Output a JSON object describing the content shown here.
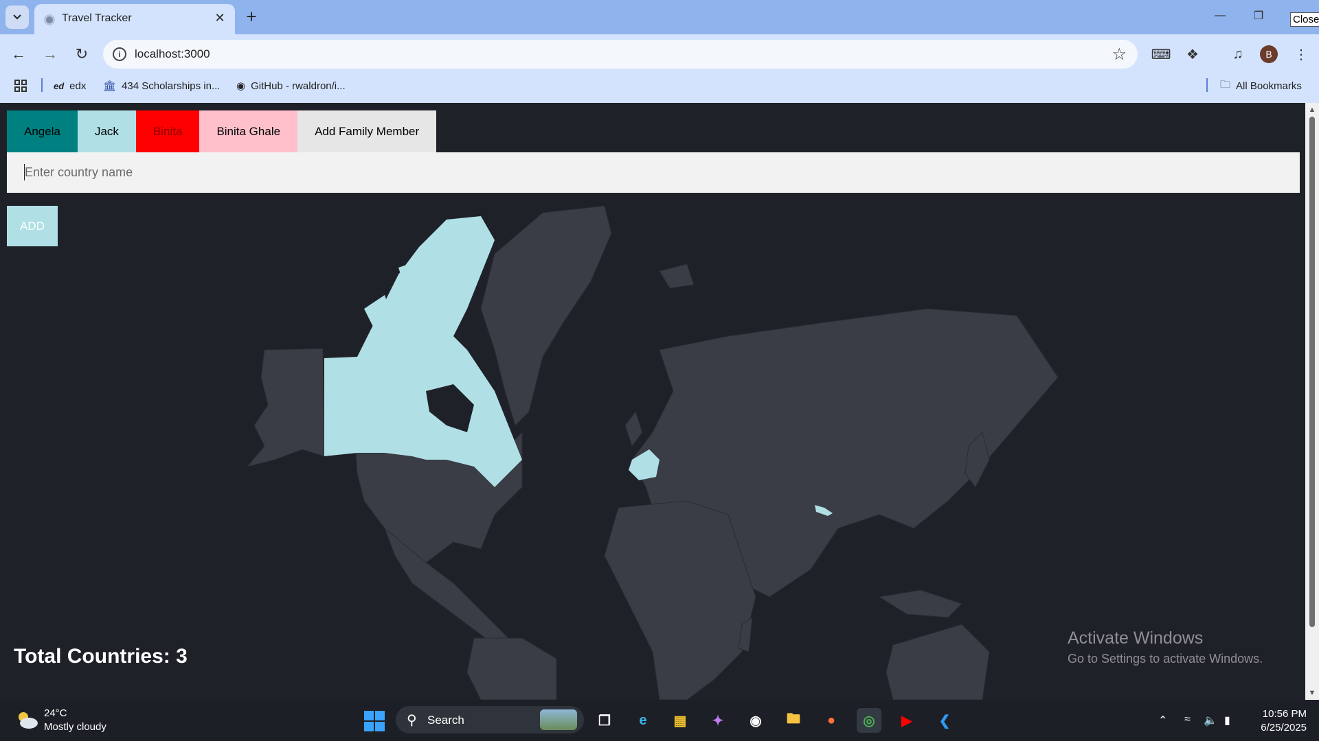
{
  "browser": {
    "tab_title": "Travel Tracker",
    "tab_close": "✕",
    "new_tab": "+",
    "url": "localhost:3000",
    "profile_initial": "B",
    "close_tooltip": "Close",
    "bookmarks": [
      {
        "label": "edx",
        "icon": "edx-icon"
      },
      {
        "label": "434 Scholarships in...",
        "icon": "institution-icon"
      },
      {
        "label": "GitHub - rwaldron/i...",
        "icon": "github-icon"
      }
    ],
    "all_bookmarks": "All Bookmarks"
  },
  "app": {
    "members": [
      {
        "label": "Angela",
        "color": "#008080",
        "text_color": "#000000"
      },
      {
        "label": "Jack",
        "color": "#b0e0e6",
        "text_color": "#000000"
      },
      {
        "label": "Binita",
        "color": "#ff0000",
        "text_color": "#8b0000"
      },
      {
        "label": "Binita Ghale",
        "color": "#ffc0cb",
        "text_color": "#000000"
      },
      {
        "label": "Add Family Member",
        "color": "#e6e6e6",
        "text_color": "#000000"
      }
    ],
    "country_placeholder": "Enter country name",
    "add_label": "ADD",
    "total_label": "Total Countries: 3",
    "visited_countries": [
      "Canada",
      "France",
      "Nepal"
    ],
    "visited_color": "#b0e0e6",
    "land_color": "#3a3d46",
    "background_color": "#1f2128"
  },
  "watermark": {
    "title": "Activate Windows",
    "subtitle": "Go to Settings to activate Windows."
  },
  "taskbar": {
    "temperature": "24°C",
    "weather": "Mostly cloudy",
    "search_label": "Search",
    "time": "10:56 PM",
    "date": "6/25/2025",
    "apps": [
      "task-view-icon",
      "edge-icon",
      "store-icon",
      "copilot-icon",
      "github-desktop-icon",
      "file-explorer-icon",
      "firefox-icon",
      "chrome-icon",
      "youtube-icon",
      "vscode-icon"
    ]
  }
}
